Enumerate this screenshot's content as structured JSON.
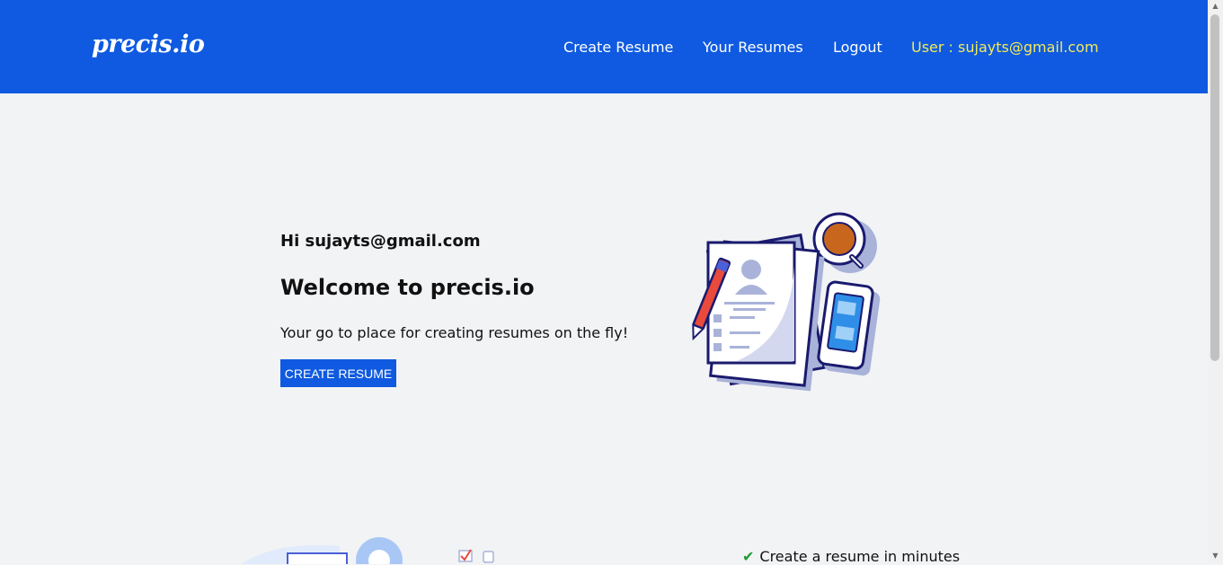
{
  "brand": {
    "logo": "precis.io"
  },
  "nav": {
    "create_resume": "Create Resume",
    "your_resumes": "Your Resumes",
    "logout": "Logout",
    "user": "User : sujayts@gmail.com"
  },
  "hero": {
    "greeting": "Hi sujayts@gmail.com",
    "title": "Welcome to precis.io",
    "tagline": "Your go to place for creating resumes on the fly!",
    "cta_label": "CREATE RESUME",
    "illustration_icon": "resume-desk-illustration-icon"
  },
  "features": {
    "items": [
      {
        "icon": "check-icon",
        "label": "Create a resume in minutes"
      }
    ]
  },
  "colors": {
    "navbar": "#0f5ae0",
    "user_text": "#f2ea5c",
    "button": "#0f5ae0",
    "page_bg": "#f2f3f5"
  }
}
